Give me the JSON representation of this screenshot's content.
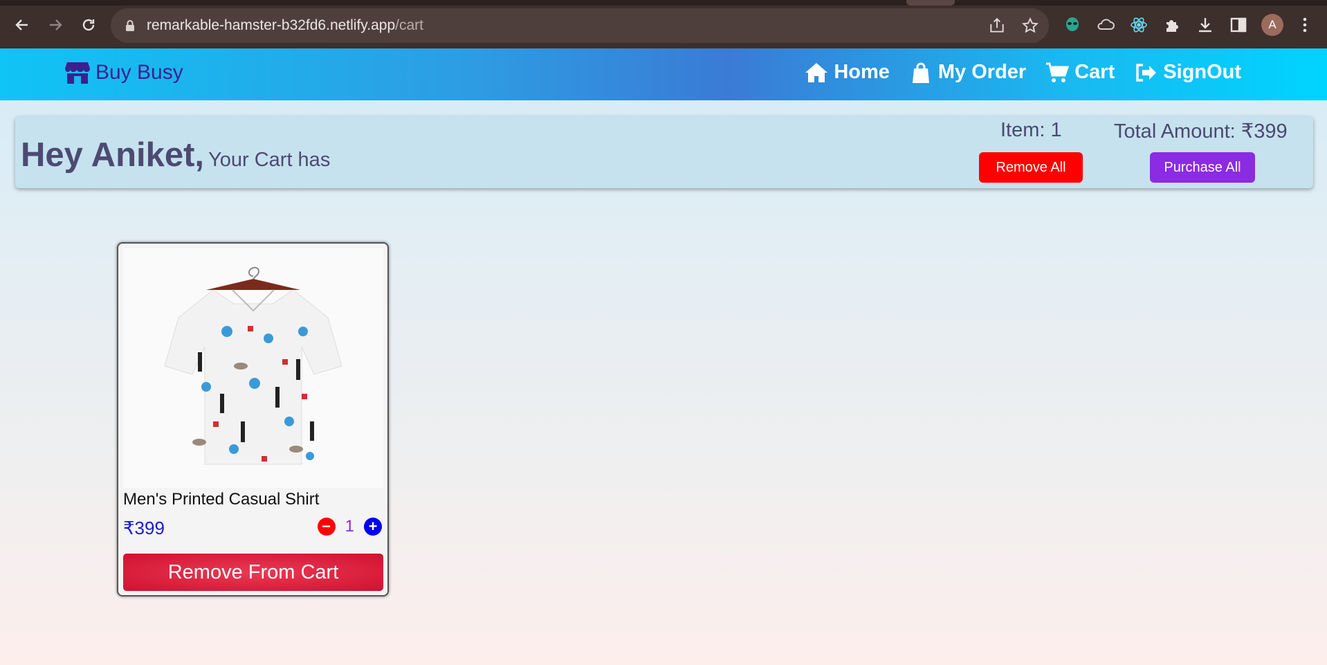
{
  "browser": {
    "url_host": "remarkable-hamster-b32fd6.netlify.app",
    "url_path": "/cart",
    "profile_initial": "A"
  },
  "navbar": {
    "brand": "Buy Busy",
    "links": [
      {
        "label": "Home",
        "icon": "home-icon"
      },
      {
        "label": "My Order",
        "icon": "shopping-bag-icon"
      },
      {
        "label": "Cart",
        "icon": "cart-icon"
      },
      {
        "label": "SignOut",
        "icon": "sign-out-icon"
      }
    ]
  },
  "summary": {
    "greeting": "Hey Aniket,",
    "subtitle": "Your Cart has",
    "item_count": "Item: 1",
    "total_amount": "Total Amount: ₹399",
    "remove_all_label": "Remove All",
    "purchase_all_label": "Purchase All"
  },
  "cart": {
    "items": [
      {
        "title": "Men's Printed Casual Shirt",
        "price": "₹399",
        "quantity": "1",
        "remove_label": "Remove From Cart"
      }
    ]
  },
  "colors": {
    "brand": "#3d1f8f",
    "remove_all": "#fe0000",
    "purchase_all": "#8b2be2",
    "remove_from_cart": "#d0112f",
    "price": "#1a1ad6"
  }
}
